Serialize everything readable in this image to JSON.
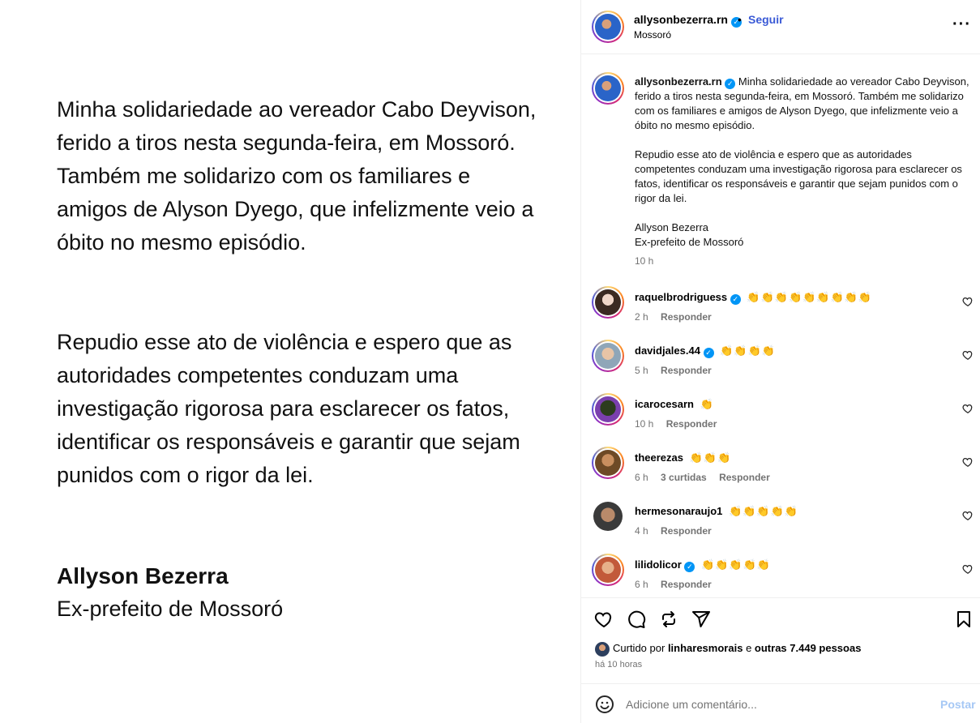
{
  "post": {
    "paragraph1": "Minha solidariedade ao vereador Cabo Deyvison, ferido a tiros nesta segunda-feira, em Mossoró. Também me solidarizo com os familiares e amigos de Alyson Dyego, que infelizmente veio a óbito no mesmo episódio.",
    "paragraph2": "Repudio esse ato de violência e espero que as autoridades competentes conduzam uma investigação rigorosa para esclarecer os fatos, identificar os responsáveis e garantir que sejam punidos com o rigor da lei.",
    "signature_name": "Allyson Bezerra",
    "signature_role": "Ex-prefeito de Mossoró"
  },
  "header": {
    "username": "allysonbezerra.rn",
    "verified_mark": "✓",
    "separator": "•",
    "follow_label": "Seguir",
    "location": "Mossoró",
    "more_label": "···"
  },
  "caption": {
    "username": "allysonbezerra.rn",
    "line1": "Minha solidariedade ao vereador Cabo Deyvison, ferido a tiros nesta segunda-feira, em Mossoró. Também me solidarizo com os familiares e amigos de Alyson Dyego, que infelizmente veio a óbito no mesmo episódio.",
    "line2": "Repudio esse ato de violência e espero que as autoridades competentes conduzam uma investigação rigorosa para esclarecer os fatos, identificar os responsáveis e garantir que sejam punidos com o rigor da lei.",
    "line3": "Allyson Bezerra",
    "line4": "Ex-prefeito de Mossoró",
    "time": "10 h"
  },
  "comments": [
    {
      "username": "raquelbrodriguess",
      "text": "👏👏👏👏👏👏👏👏👏",
      "time": "2 h",
      "likes": "",
      "reply": "Responder"
    },
    {
      "username": "davidjales.44",
      "text": "👏👏👏👏",
      "time": "5 h",
      "likes": "",
      "reply": "Responder"
    },
    {
      "username": "icarocesarn",
      "text": "👏",
      "time": "10 h",
      "likes": "",
      "reply": "Responder"
    },
    {
      "username": "theerezas",
      "text": "👏👏👏",
      "time": "6 h",
      "likes": "3 curtidas",
      "reply": "Responder"
    },
    {
      "username": "hermesonaraujo1",
      "text": "👏👏👏👏👏",
      "time": "4 h",
      "likes": "",
      "reply": "Responder"
    },
    {
      "username": "lilidolicor",
      "text": "👏👏👏👏👏",
      "time": "6 h",
      "likes": "",
      "reply": "Responder"
    }
  ],
  "likes": {
    "prefix": "Curtido por",
    "user": "linharesmorais",
    "middle": "e",
    "others": "outras 7.449 pessoas"
  },
  "ago": "há 10 horas",
  "add_comment": {
    "placeholder": "Adicione um comentário...",
    "post_label": "Postar"
  },
  "colors": {
    "follow": "#3a5ad6",
    "verified": "#0095f6",
    "muted": "#737373",
    "post_disabled": "#a6c8f5"
  }
}
